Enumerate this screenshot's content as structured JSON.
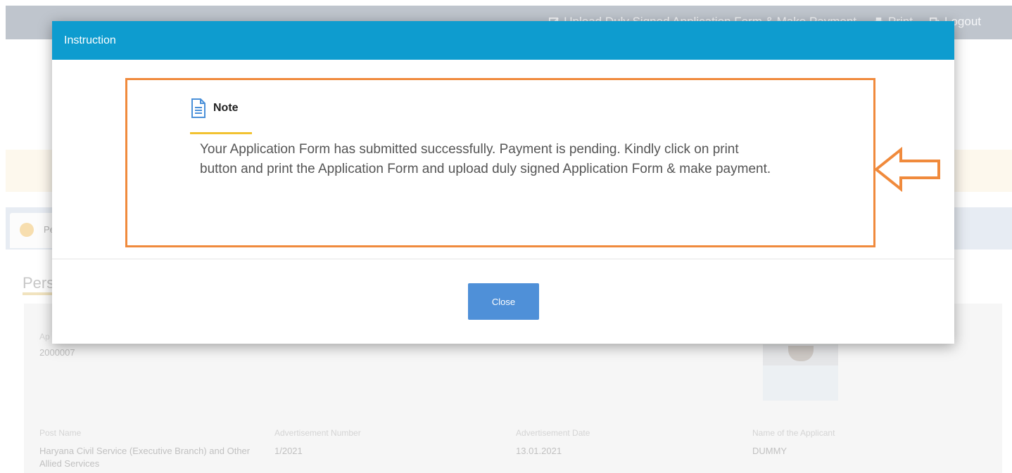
{
  "topnav": {
    "upload_label": "Upload Duly Signed Application Form & Make Payment",
    "print_label": "Print",
    "logout_label": "Logout"
  },
  "tabs": [
    {
      "label": "Pe"
    }
  ],
  "section": {
    "title": "Pers"
  },
  "details": {
    "application_no_label": "Ap",
    "application_no": "2000007",
    "fields": [
      {
        "label": "Post Name",
        "value": "Haryana Civil Service (Executive Branch) and Other Allied Services"
      },
      {
        "label": "Advertisement Number",
        "value": "1/2021"
      },
      {
        "label": "Advertisement Date",
        "value": "13.01.2021"
      },
      {
        "label": "Name of the Applicant",
        "value": "DUMMY"
      }
    ]
  },
  "modal": {
    "title": "Instruction",
    "note_title": "Note",
    "note_text": "Your Application Form has submitted successfully. Payment is pending. Kindly click on print button and print the Application Form and upload duly signed Application Form & make payment.",
    "close_label": "Close"
  },
  "colors": {
    "modal_header": "#0e9ccf",
    "highlight_border": "#f08a3c",
    "note_underline": "#f2c230",
    "close_button": "#4f90d8"
  },
  "icons": [
    "edit-icon",
    "print-icon",
    "logout-icon",
    "document-icon",
    "arrow-left-icon"
  ]
}
